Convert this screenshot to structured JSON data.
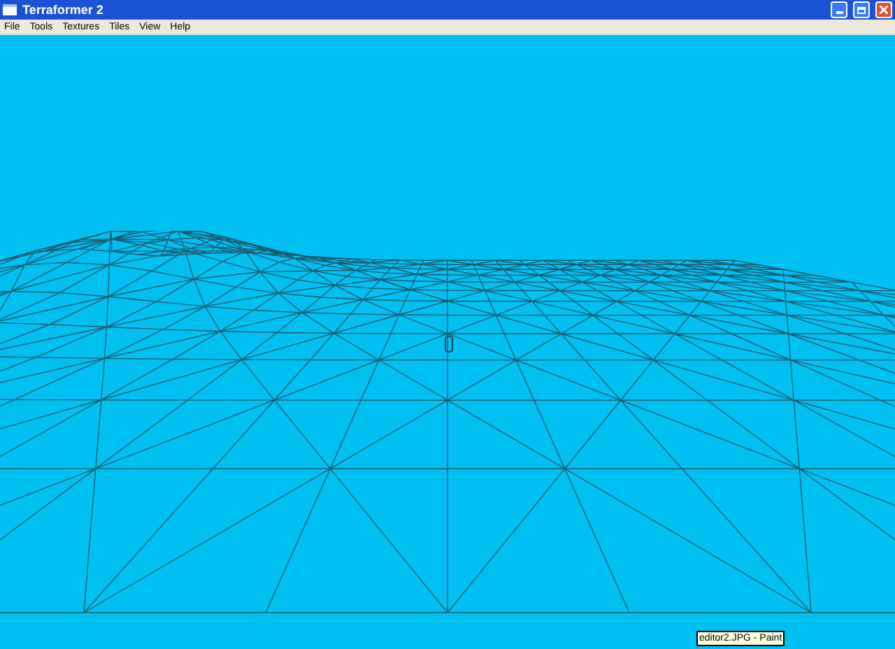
{
  "window": {
    "title": "Terraformer 2"
  },
  "menu": [
    "File",
    "Tools",
    "Textures",
    "Tiles",
    "View",
    "Help"
  ],
  "tooltip": {
    "text": "editor2.JPG - Paint"
  }
}
